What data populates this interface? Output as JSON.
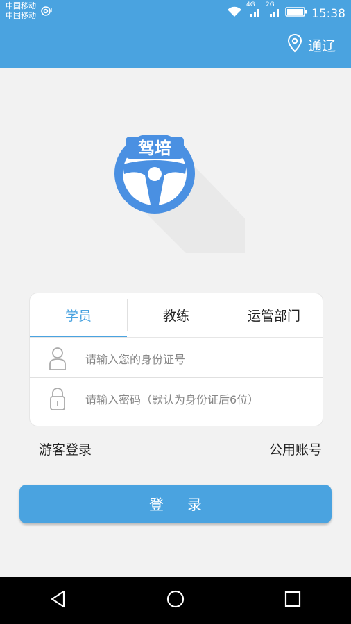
{
  "status_bar": {
    "carrier_line1": "中国移动",
    "carrier_line2": "中国移动",
    "network_4g": "4G",
    "network_2g": "2G",
    "time": "15:38"
  },
  "header": {
    "location_label": "通辽"
  },
  "logo": {
    "text": "驾培"
  },
  "login_card": {
    "tabs": [
      {
        "label": "学员",
        "active": true
      },
      {
        "label": "教练",
        "active": false
      },
      {
        "label": "运管部门",
        "active": false
      }
    ],
    "id_placeholder": "请输入您的身份证号",
    "password_placeholder": "请输入密码（默认为身份证后6位）"
  },
  "links": {
    "guest_login": "游客登录",
    "public_account": "公用账号"
  },
  "login_button": "登录",
  "colors": {
    "accent": "#4aa3e0",
    "background": "#f2f2f2"
  },
  "icons": [
    "location-pin-icon",
    "user-icon",
    "lock-icon",
    "back-icon",
    "home-icon",
    "recents-icon",
    "wifi-icon",
    "battery-icon"
  ]
}
